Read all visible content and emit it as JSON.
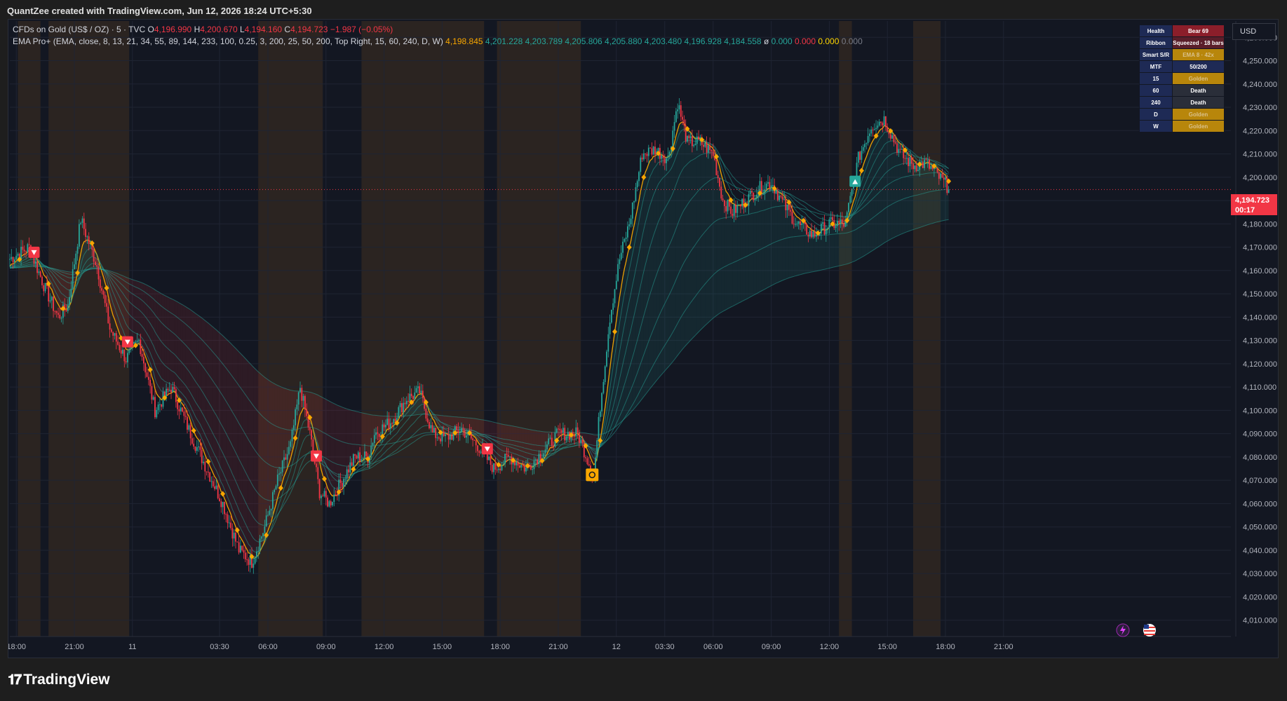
{
  "header": {
    "caption": "QuantZee created with TradingView.com, Jun 12, 2026 18:24 UTC+5:30"
  },
  "legend": {
    "symbol": "CFDs on Gold (US$ / OZ) · 5 · TVC",
    "o_label": "O",
    "o_value": "4,196.990",
    "h_label": "H",
    "h_value": "4,200.670",
    "l_label": "L",
    "l_value": "4,194.160",
    "c_label": "C",
    "c_value": "4,194.723",
    "change": "−1.987 (−0.05%)",
    "indicator": "EMA Pro+ (EMA, close, 8, 13, 21, 34, 55, 89, 144, 233, 100, 0.25, 3, 200, 25, 50, 200, Top Right, 15, 60, 240, D, W)",
    "ema_values": [
      {
        "text": "4,198.845",
        "color": "#f7a600"
      },
      {
        "text": "4,201.228",
        "color": "#26a69a"
      },
      {
        "text": "4,203.789",
        "color": "#26a69a"
      },
      {
        "text": "4,205.806",
        "color": "#26a69a"
      },
      {
        "text": "4,205.880",
        "color": "#26a69a"
      },
      {
        "text": "4,203.480",
        "color": "#26a69a"
      },
      {
        "text": "4,196.928",
        "color": "#26a69a"
      },
      {
        "text": "4,184.558",
        "color": "#26a69a"
      }
    ],
    "tail_symbol": "ø",
    "tail_values": [
      {
        "text": "0.000",
        "color": "#26a69a"
      },
      {
        "text": "0.000",
        "color": "#f23645"
      },
      {
        "text": "0.000",
        "color": "#ffd600"
      },
      {
        "text": "0.000",
        "color": "#787b86"
      }
    ]
  },
  "dashboard": [
    {
      "key": "Health",
      "value": "Bear 69",
      "bg": "#8b1e2a",
      "fg": "#ffffff"
    },
    {
      "key": "Ribbon",
      "value": "Squeezed · 18 bars",
      "bg": "#5a1e2a",
      "fg": "#ffffff"
    },
    {
      "key": "Smart S/R",
      "value": "EMA 8 · 42x",
      "bg": "#b8860b",
      "fg": "#d9c08a"
    },
    {
      "key": "MTF",
      "value": "50/200",
      "bg": "#1e2a55",
      "fg": "#ffffff"
    },
    {
      "key": "15",
      "value": "Golden",
      "bg": "#b8860b",
      "fg": "#d9c08a"
    },
    {
      "key": "60",
      "value": "Death",
      "bg": "#2a2e39",
      "fg": "#ffffff"
    },
    {
      "key": "240",
      "value": "Death",
      "bg": "#2a2e39",
      "fg": "#ffffff"
    },
    {
      "key": "D",
      "value": "Golden",
      "bg": "#b8860b",
      "fg": "#d9c08a"
    },
    {
      "key": "W",
      "value": "Golden",
      "bg": "#b8860b",
      "fg": "#d9c08a"
    }
  ],
  "currency": "USD",
  "last_price": {
    "value": "4,194.723",
    "countdown": "00:17"
  },
  "branding": {
    "name": "TradingView"
  },
  "chart_data": {
    "type": "candlestick",
    "symbol": "CFDs on Gold (US$ / OZ)",
    "interval": "5",
    "ylim": [
      4003,
      4267
    ],
    "y_ticks": [
      4010,
      4020,
      4030,
      4040,
      4050,
      4060,
      4070,
      4080,
      4090,
      4100,
      4110,
      4120,
      4130,
      4140,
      4150,
      4160,
      4170,
      4180,
      4190,
      4200,
      4210,
      4220,
      4230,
      4240,
      4250,
      4260
    ],
    "x_ticks": [
      {
        "label": "18:00",
        "i": 4
      },
      {
        "label": "21:00",
        "i": 40
      },
      {
        "label": "11",
        "i": 76
      },
      {
        "label": "03:30",
        "i": 130
      },
      {
        "label": "06:00",
        "i": 160
      },
      {
        "label": "09:00",
        "i": 196
      },
      {
        "label": "12:00",
        "i": 232
      },
      {
        "label": "15:00",
        "i": 268
      },
      {
        "label": "18:00",
        "i": 304
      },
      {
        "label": "21:00",
        "i": 340
      },
      {
        "label": "12",
        "i": 376
      },
      {
        "label": "03:30",
        "i": 406
      },
      {
        "label": "06:00",
        "i": 436
      },
      {
        "label": "09:00",
        "i": 472
      },
      {
        "label": "12:00",
        "i": 508
      },
      {
        "label": "15:00",
        "i": 544
      },
      {
        "label": "18:00",
        "i": 580
      },
      {
        "label": "21:00",
        "i": 616
      }
    ],
    "bar_count": 583,
    "last_price": 4194.723,
    "close_path": [
      [
        0,
        4165
      ],
      [
        12,
        4170
      ],
      [
        22,
        4152
      ],
      [
        30,
        4140
      ],
      [
        36,
        4145
      ],
      [
        44,
        4182
      ],
      [
        54,
        4162
      ],
      [
        62,
        4135
      ],
      [
        72,
        4122
      ],
      [
        80,
        4130
      ],
      [
        90,
        4100
      ],
      [
        100,
        4110
      ],
      [
        112,
        4090
      ],
      [
        122,
        4075
      ],
      [
        132,
        4060
      ],
      [
        142,
        4040
      ],
      [
        150,
        4035
      ],
      [
        158,
        4050
      ],
      [
        166,
        4070
      ],
      [
        174,
        4085
      ],
      [
        180,
        4110
      ],
      [
        186,
        4090
      ],
      [
        192,
        4065
      ],
      [
        198,
        4060
      ],
      [
        206,
        4070
      ],
      [
        214,
        4080
      ],
      [
        222,
        4080
      ],
      [
        226,
        4090
      ],
      [
        236,
        4095
      ],
      [
        246,
        4105
      ],
      [
        254,
        4108
      ],
      [
        262,
        4090
      ],
      [
        270,
        4088
      ],
      [
        280,
        4092
      ],
      [
        290,
        4085
      ],
      [
        300,
        4075
      ],
      [
        310,
        4080
      ],
      [
        320,
        4075
      ],
      [
        330,
        4082
      ],
      [
        340,
        4090
      ],
      [
        352,
        4090
      ],
      [
        362,
        4072
      ],
      [
        366,
        4102
      ],
      [
        372,
        4140
      ],
      [
        378,
        4165
      ],
      [
        384,
        4180
      ],
      [
        392,
        4210
      ],
      [
        400,
        4212
      ],
      [
        408,
        4208
      ],
      [
        414,
        4232
      ],
      [
        420,
        4215
      ],
      [
        428,
        4215
      ],
      [
        436,
        4210
      ],
      [
        442,
        4190
      ],
      [
        448,
        4185
      ],
      [
        456,
        4190
      ],
      [
        464,
        4195
      ],
      [
        472,
        4198
      ],
      [
        480,
        4188
      ],
      [
        488,
        4180
      ],
      [
        498,
        4175
      ],
      [
        508,
        4180
      ],
      [
        518,
        4180
      ],
      [
        526,
        4208
      ],
      [
        534,
        4222
      ],
      [
        542,
        4225
      ],
      [
        552,
        4210
      ],
      [
        560,
        4205
      ],
      [
        568,
        4206
      ],
      [
        576,
        4200
      ],
      [
        583,
        4194.7
      ]
    ],
    "ema_periods": [
      8,
      13,
      21,
      34,
      55,
      89,
      144,
      233
    ],
    "signals": [
      {
        "i": 15,
        "type": "sell"
      },
      {
        "i": 73,
        "type": "sell"
      },
      {
        "i": 190,
        "type": "sell"
      },
      {
        "i": 296,
        "type": "sell"
      },
      {
        "i": 361,
        "type": "cross"
      },
      {
        "i": 524,
        "type": "buy"
      }
    ],
    "sessions": [
      {
        "from": 5,
        "to": 19,
        "color": "#f7931a"
      },
      {
        "from": 24,
        "to": 74,
        "color": "#f7931a"
      },
      {
        "from": 154,
        "to": 194,
        "color": "#f7931a"
      },
      {
        "from": 218,
        "to": 294,
        "color": "#f7931a"
      },
      {
        "from": 302,
        "to": 354,
        "color": "#f7931a"
      },
      {
        "from": 514,
        "to": 522,
        "color": "#f7931a"
      },
      {
        "from": 560,
        "to": 577,
        "color": "#f7931a"
      }
    ],
    "colors": {
      "up": "#26a69a",
      "down": "#f23645",
      "bear_ribbon": "#f23645",
      "bull_ribbon": "#26a69a",
      "signal_diamond": "#f7a600",
      "grid": "#1f2433",
      "axis_text": "#b2b5be"
    }
  }
}
